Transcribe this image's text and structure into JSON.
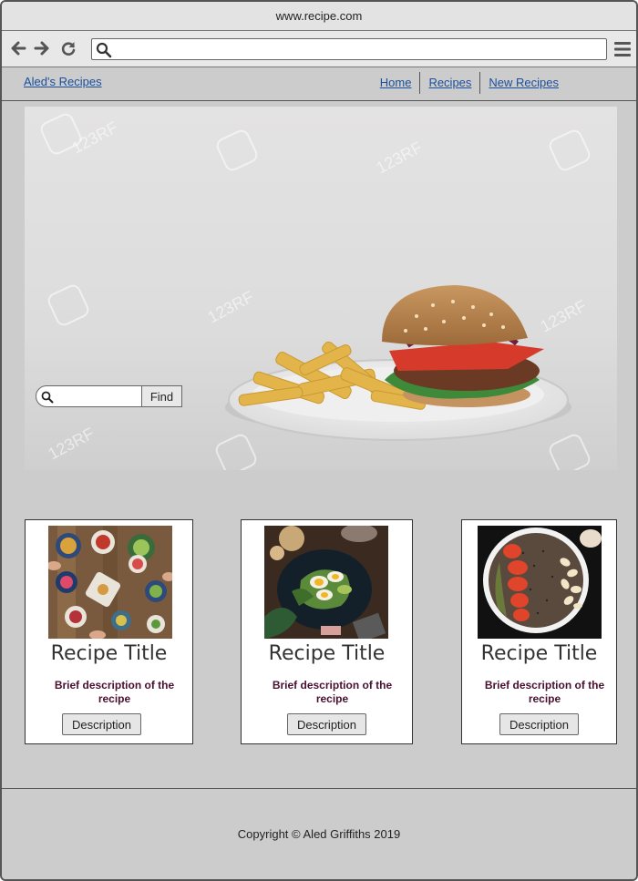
{
  "browser": {
    "url": "www.recipe.com",
    "address_value": "",
    "address_placeholder": ""
  },
  "site": {
    "brand": "Aled's Recipes",
    "nav": [
      {
        "label": "Home"
      },
      {
        "label": "Recipes"
      },
      {
        "label": "New Recipes"
      }
    ]
  },
  "hero": {
    "search_value": "",
    "find_label": "Find",
    "watermark": "123RF"
  },
  "cards": [
    {
      "title": "Recipe Title",
      "description": "Brief description of the recipe",
      "button": "Description"
    },
    {
      "title": "Recipe Title",
      "description": "Brief description of the recipe",
      "button": "Description"
    },
    {
      "title": "Recipe Title",
      "description": "Brief description of the recipe",
      "button": "Description"
    }
  ],
  "footer": {
    "copyright": "Copyright © Aled Griffiths 2019"
  },
  "colors": {
    "page_bg": "#cccccc",
    "link": "#1a4f9c",
    "description_text": "#4a1030"
  }
}
